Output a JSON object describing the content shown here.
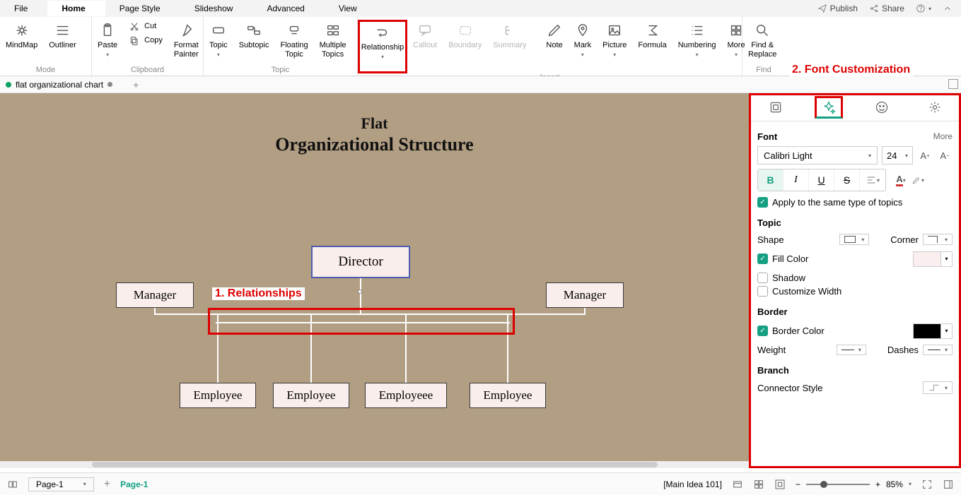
{
  "menu": {
    "file": "File",
    "home": "Home",
    "page_style": "Page Style",
    "slideshow": "Slideshow",
    "advanced": "Advanced",
    "view": "View"
  },
  "topbar_right": {
    "publish": "Publish",
    "share": "Share"
  },
  "ribbon": {
    "mode_label": "Mode",
    "clipboard_label": "Clipboard",
    "topic_label": "Topic",
    "insert_label": "Insert",
    "find_label": "Find",
    "mindmap": "MindMap",
    "outliner": "Outliner",
    "paste": "Paste",
    "cut": "Cut",
    "copy": "Copy",
    "format_painter": "Format\nPainter",
    "topic": "Topic",
    "subtopic": "Subtopic",
    "floating_topic": "Floating\nTopic",
    "multiple_topics": "Multiple\nTopics",
    "relationship": "Relationship",
    "callout": "Callout",
    "boundary": "Boundary",
    "summary": "Summary",
    "note": "Note",
    "mark": "Mark",
    "picture": "Picture",
    "formula": "Formula",
    "numbering": "Numbering",
    "more": "More",
    "find_replace": "Find &\nReplace"
  },
  "annotations": {
    "a1": "1. Relationships",
    "a2": "2. Font Customization"
  },
  "doc_tab": {
    "name": "flat organizational chart"
  },
  "canvas": {
    "title1": "Flat",
    "title2": "Organizational Structure",
    "director": "Director",
    "manager": "Manager",
    "employee": "Employee",
    "employeee": "Employeee"
  },
  "side": {
    "font_head": "Font",
    "more": "More",
    "font_name": "Calibri Light",
    "font_size": "24",
    "bold": "B",
    "italic": "I",
    "underline": "U",
    "strike": "S",
    "apply_same": "Apply to the same type of topics",
    "topic_head": "Topic",
    "shape": "Shape",
    "corner": "Corner",
    "fill_color": "Fill Color",
    "shadow": "Shadow",
    "custom_width": "Customize Width",
    "border_head": "Border",
    "border_color": "Border Color",
    "weight": "Weight",
    "dashes": "Dashes",
    "branch_head": "Branch",
    "connector_style": "Connector Style"
  },
  "status": {
    "page_sel": "Page-1",
    "page_active": "Page-1",
    "main_idea": "[Main Idea 101]",
    "zoom": "85%"
  }
}
